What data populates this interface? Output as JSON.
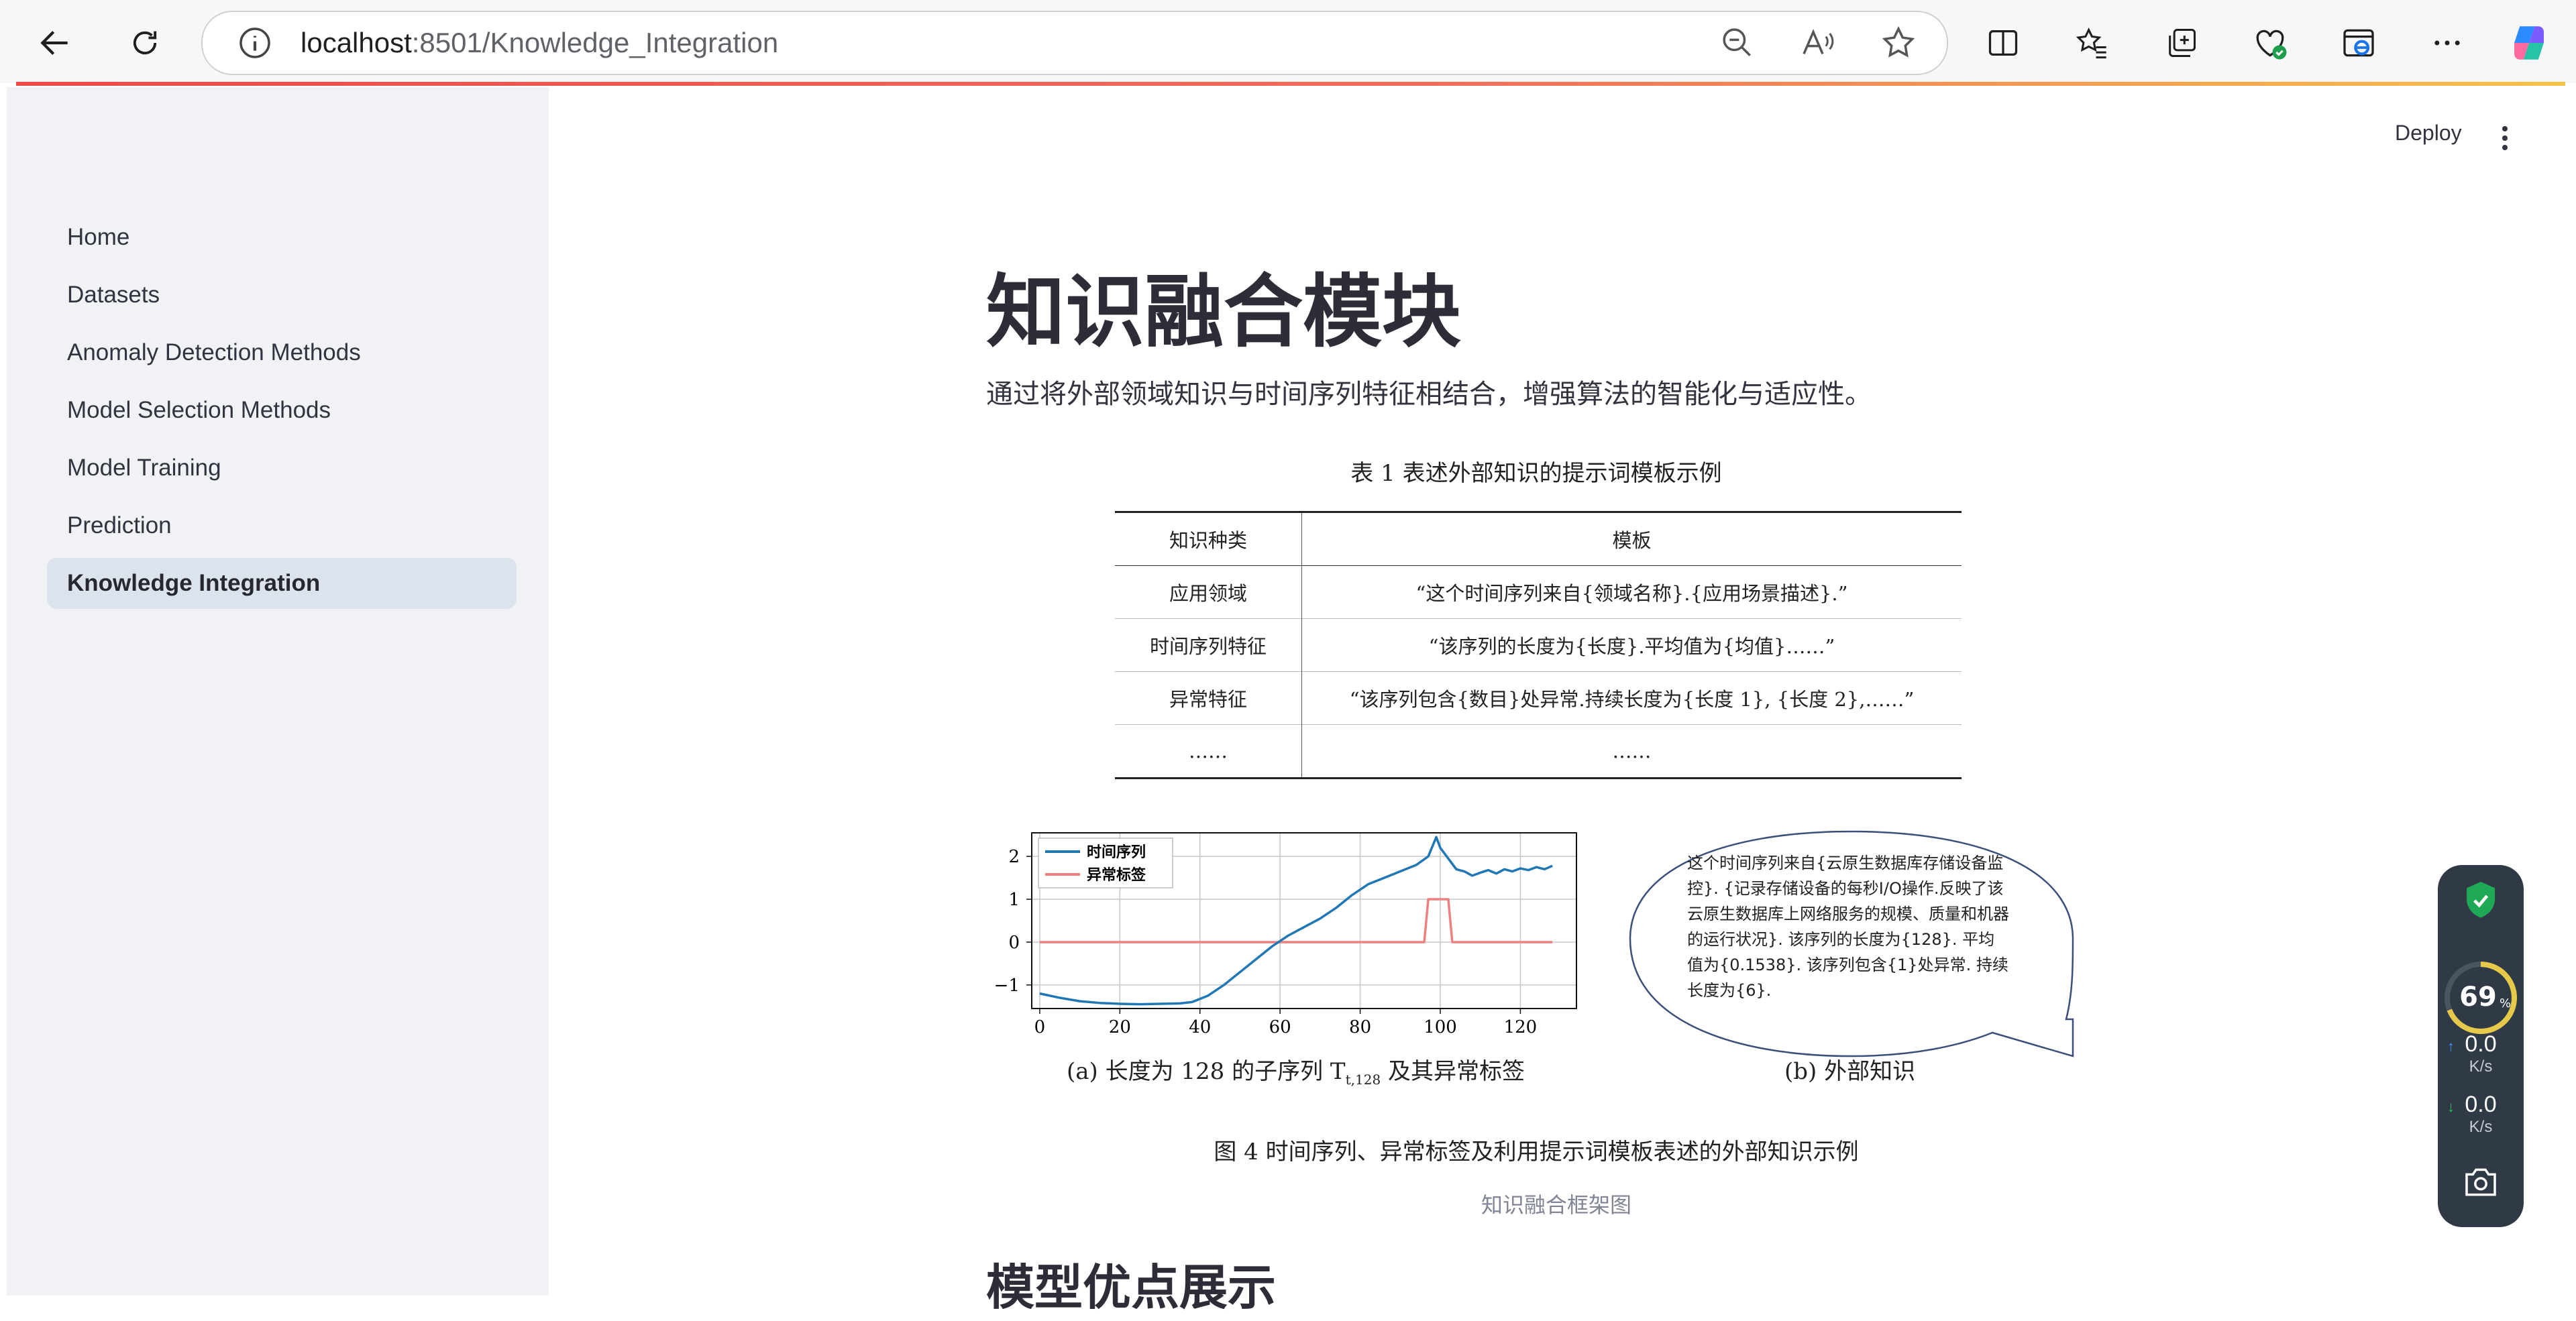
{
  "browser": {
    "url_host": "localhost",
    "url_path": ":8501/Knowledge_Integration"
  },
  "header": {
    "deploy_label": "Deploy"
  },
  "sidebar": {
    "items": [
      {
        "label": "Home"
      },
      {
        "label": "Datasets"
      },
      {
        "label": "Anomaly Detection Methods"
      },
      {
        "label": "Model Selection Methods"
      },
      {
        "label": "Model Training"
      },
      {
        "label": "Prediction"
      },
      {
        "label": "Knowledge Integration",
        "active": true
      }
    ]
  },
  "main": {
    "title": "知识融合模块",
    "subtitle": "通过将外部领域知识与时间序列特征相结合，增强算法的智能化与适应性。",
    "image_caption": "知识融合框架图",
    "next_heading": "模型优点展示"
  },
  "figure": {
    "table_caption": "表 1 表述外部知识的提示词模板示例",
    "table_headers": [
      "知识种类",
      "模板"
    ],
    "table_rows": [
      [
        "应用领域",
        "“这个时间序列来自{领域名称}.{应用场景描述}.”"
      ],
      [
        "时间序列特征",
        "“该序列的长度为{长度}.平均值为{均值}……”"
      ],
      [
        "异常特征",
        "“该序列包含{数目}处异常.持续长度为{长度 1}, {长度 2},……”"
      ],
      [
        "……",
        "……"
      ]
    ],
    "legend_series": "时间序列",
    "legend_labels": "异常标签",
    "caption_a": "(a) 长度为 128 的子序列 T",
    "caption_a_sub": "t,128",
    "caption_a_tail": " 及其异常标签",
    "caption_b": "(b) 外部知识",
    "bubble_text": "这个时间序列来自{云原生数据库存储设备监控}. {记录存储设备的每秒I/O操作.反映了该云原生数据库上网络服务的规模、质量和机器的运行状况}. 该序列的长度为{128}. 平均值为{0.1538}. 该序列包含{1}处异常. 持续长度为{6}.",
    "figure_caption": "图 4 时间序列、异常标签及利用提示词模板表述的外部知识示例"
  },
  "chart_data": {
    "type": "line",
    "x_ticks": [
      0,
      20,
      40,
      60,
      80,
      100,
      120
    ],
    "y_ticks": [
      2,
      1,
      0,
      -1
    ],
    "xlim": [
      -2,
      134
    ],
    "ylim": [
      -1.55,
      2.55
    ],
    "grid": true,
    "legend_placement": "top-left",
    "series": [
      {
        "name": "时间序列",
        "color": "#1f77b4",
        "x": [
          0,
          5,
          10,
          15,
          20,
          25,
          30,
          35,
          38,
          42,
          46,
          50,
          54,
          58,
          62,
          66,
          70,
          74,
          78,
          82,
          86,
          90,
          94,
          97,
          99,
          100,
          102,
          104,
          106,
          108,
          110,
          112,
          114,
          116,
          118,
          120,
          122,
          124,
          126,
          128
        ],
        "y": [
          -1.2,
          -1.3,
          -1.38,
          -1.42,
          -1.44,
          -1.45,
          -1.44,
          -1.43,
          -1.4,
          -1.25,
          -1.0,
          -0.7,
          -0.4,
          -0.1,
          0.15,
          0.35,
          0.55,
          0.8,
          1.1,
          1.35,
          1.5,
          1.65,
          1.8,
          2.0,
          2.45,
          2.2,
          1.95,
          1.7,
          1.65,
          1.55,
          1.62,
          1.68,
          1.6,
          1.7,
          1.65,
          1.72,
          1.68,
          1.75,
          1.7,
          1.78
        ]
      },
      {
        "name": "异常标签",
        "color": "#f08080",
        "x": [
          0,
          96,
          97,
          102,
          103,
          128
        ],
        "y": [
          0,
          0,
          1,
          1,
          0,
          0
        ]
      }
    ]
  },
  "widget": {
    "percent": "69",
    "percent_unit": "%",
    "upload": "0.0",
    "download": "0.0",
    "rate_unit": "K/s"
  }
}
